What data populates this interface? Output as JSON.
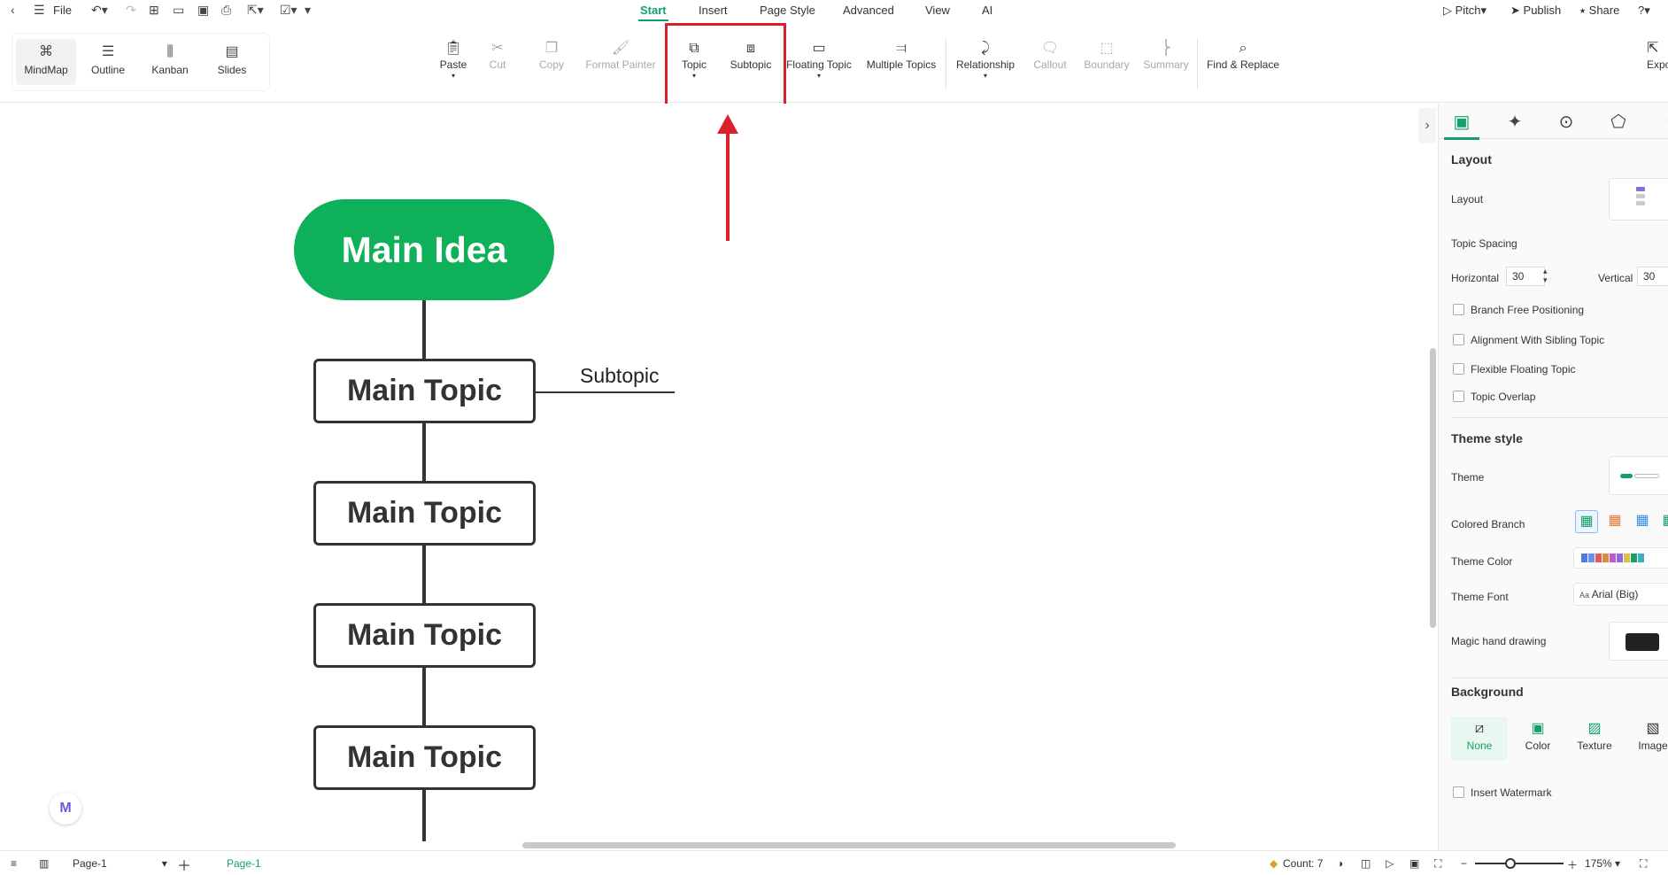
{
  "topbar": {
    "file_label": "File",
    "tabs": [
      "Start",
      "Insert",
      "Page Style",
      "Advanced",
      "View",
      "AI"
    ],
    "active_tab": "Start",
    "pitch_label": "Pitch",
    "publish_label": "Publish",
    "share_label": "Share",
    "help_label": "?"
  },
  "views": [
    "MindMap",
    "Outline",
    "Kanban",
    "Slides"
  ],
  "toolbar": {
    "paste": "Paste",
    "cut": "Cut",
    "copy": "Copy",
    "format_painter": "Format Painter",
    "topic": "Topic",
    "subtopic": "Subtopic",
    "floating_topic": "Floating Topic",
    "multiple_topics": "Multiple Topics",
    "relationship": "Relationship",
    "callout": "Callout",
    "boundary": "Boundary",
    "summary": "Summary",
    "find_replace": "Find & Replace",
    "export": "Expo"
  },
  "canvas": {
    "main_idea": "Main Idea",
    "main_topics": [
      "Main Topic",
      "Main Topic",
      "Main Topic",
      "Main Topic"
    ],
    "subtopic": "Subtopic",
    "highlight_color": "#d9202c",
    "accent_color": "#0fb05a"
  },
  "panel": {
    "layout_heading": "Layout",
    "layout_label": "Layout",
    "topic_spacing_label": "Topic Spacing",
    "horizontal_label": "Horizontal",
    "horizontal_value": "30",
    "vertical_label": "Vertical",
    "vertical_value": "30",
    "checkboxes": [
      "Branch Free Positioning",
      "Alignment With Sibling Topic",
      "Flexible Floating Topic",
      "Topic Overlap"
    ],
    "theme_style_heading": "Theme style",
    "theme_label": "Theme",
    "colored_branch_label": "Colored Branch",
    "theme_color_label": "Theme Color",
    "theme_font_label": "Theme Font",
    "theme_font_value": "Arial (Big)",
    "theme_font_prefix": "Aa",
    "magic_hand_label": "Magic hand drawing",
    "background_heading": "Background",
    "background_options": [
      "None",
      "Color",
      "Texture",
      "Image"
    ],
    "insert_watermark_label": "Insert Watermark"
  },
  "statusbar": {
    "page_select": "Page-1",
    "page_tab": "Page-1",
    "count": "Count: 7",
    "zoom": "175%"
  }
}
